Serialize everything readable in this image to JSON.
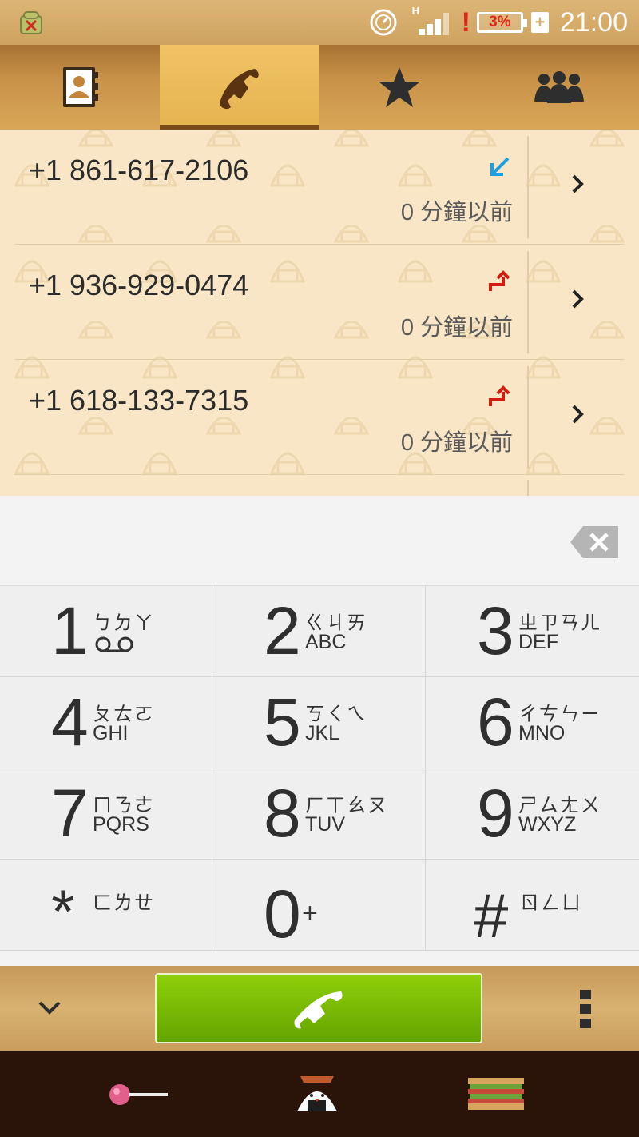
{
  "status_bar": {
    "network": "H",
    "battery_percent": "3%",
    "battery_charging": "+",
    "alert": "!",
    "time": "21:00"
  },
  "tabs": [
    {
      "name": "contacts",
      "icon": "contacts-book-icon",
      "active": false
    },
    {
      "name": "phone",
      "icon": "phone-handset-icon",
      "active": true
    },
    {
      "name": "favorites",
      "icon": "star-icon",
      "active": false
    },
    {
      "name": "groups",
      "icon": "people-group-icon",
      "active": false
    }
  ],
  "call_log": [
    {
      "number": "+1 861-617-2106",
      "time": "0 分鐘以前",
      "direction": "incoming"
    },
    {
      "number": "+1 936-929-0474",
      "time": "0 分鐘以前",
      "direction": "outgoing"
    },
    {
      "number": "+1 618-133-7315",
      "time": "0 分鐘以前",
      "direction": "outgoing"
    }
  ],
  "dialpad": {
    "keys": [
      {
        "digit": "1",
        "zhuyin": "ㄅㄉㄚ",
        "letters": ""
      },
      {
        "digit": "2",
        "zhuyin": "ㄍㄐㄞ",
        "letters": "ABC"
      },
      {
        "digit": "3",
        "zhuyin": "ㄓㄗㄢㄦ",
        "letters": "DEF"
      },
      {
        "digit": "4",
        "zhuyin": "ㄆㄊㄛ",
        "letters": "GHI"
      },
      {
        "digit": "5",
        "zhuyin": "ㄎㄑㄟ",
        "letters": "JKL"
      },
      {
        "digit": "6",
        "zhuyin": "ㄔㄘㄣㄧ",
        "letters": "MNO"
      },
      {
        "digit": "7",
        "zhuyin": "ㄇㄋㄜ",
        "letters": "PQRS"
      },
      {
        "digit": "8",
        "zhuyin": "ㄏㄒㄠㄡ",
        "letters": "TUV"
      },
      {
        "digit": "9",
        "zhuyin": "ㄕㄙㄤㄨ",
        "letters": "WXYZ"
      },
      {
        "digit": "*",
        "zhuyin": "ㄈㄌㄝ",
        "letters": ""
      },
      {
        "digit": "0",
        "zhuyin": "+",
        "letters": ""
      },
      {
        "digit": "#",
        "zhuyin": "ㄖㄥㄩ",
        "letters": ""
      }
    ]
  },
  "colors": {
    "accent_tab": "#e6b350",
    "call_green": "#7cbd04",
    "incoming_arrow": "#1aa0e0",
    "outgoing_arrow": "#d21c12"
  },
  "dock": [
    "lollipop-icon",
    "onigiri-icon",
    "sandwich-icon"
  ]
}
